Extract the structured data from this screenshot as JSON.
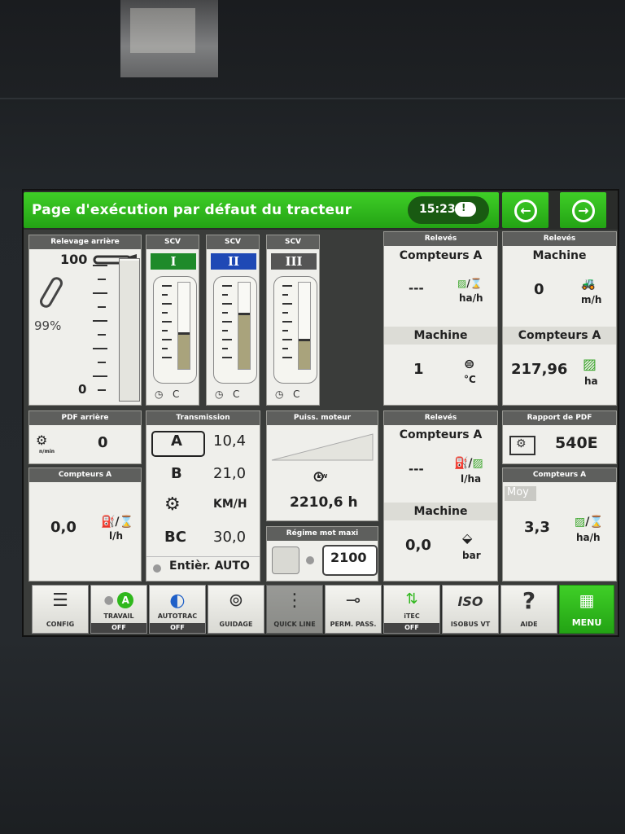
{
  "header": {
    "title": "Page d'exécution par défaut du tracteur",
    "time": "15:23"
  },
  "relevage": {
    "title": "Relevage arrière",
    "top": "100",
    "percent": "99%",
    "bottom": "0",
    "level": 0.99
  },
  "scv": [
    {
      "title": "SCV",
      "roman": "I",
      "color": "#1f8a2a",
      "level": 0.4
    },
    {
      "title": "SCV",
      "roman": "II",
      "color": "#1f49b5",
      "level": 0.62
    },
    {
      "title": "SCV",
      "roman": "III",
      "color": "#555555",
      "level": 0.32
    }
  ],
  "scv_labels": {
    "c": "C"
  },
  "releves_left": {
    "title": "Relevés",
    "sub1": "Compteurs A",
    "v1": "---",
    "u1": "ha/h",
    "sub2": "Machine",
    "v2": "1",
    "u2": "°C"
  },
  "releves_right": {
    "title": "Relevés",
    "sub1": "Machine",
    "v1": "0",
    "u1": "m/h",
    "sub2": "Compteurs A",
    "v2": "217,96",
    "u2": "ha"
  },
  "pdf_arriere": {
    "title": "PDF arrière",
    "value": "0",
    "unit": "n/min"
  },
  "compteurs_a_left": {
    "title": "Compteurs A",
    "value": "0,0",
    "unit": "l/h"
  },
  "transmission": {
    "title": "Transmission",
    "rows": [
      {
        "label": "A",
        "value": "10,4"
      },
      {
        "label": "B",
        "value": "21,0"
      },
      {
        "label": "",
        "value": "KM/H"
      },
      {
        "label": "BC",
        "value": "30,0"
      }
    ],
    "mode": "Entièr. AUTO"
  },
  "puissance": {
    "title": "Puiss. moteur",
    "value": "2210,6 h",
    "icon_label": "kW"
  },
  "regime": {
    "title": "Régime mot maxi",
    "value": "2100"
  },
  "releves_mid": {
    "title": "Relevés",
    "sub1": "Compteurs A",
    "v1": "---",
    "u1": "l/ha",
    "sub2": "Machine",
    "v2": "0,0",
    "u2": "bar"
  },
  "rapport_pdf": {
    "title": "Rapport de PDF",
    "value": "540E"
  },
  "compteurs_a_right": {
    "title": "Compteurs A",
    "moy": "Moy",
    "value": "3,3",
    "unit": "ha/h"
  },
  "dock": [
    {
      "label": "CONFIG",
      "off": ""
    },
    {
      "label": "TRAVAIL",
      "off": "OFF"
    },
    {
      "label": "AUTOTRAC",
      "off": "OFF"
    },
    {
      "label": "GUIDAGE",
      "off": ""
    },
    {
      "label": "QUICK LINE",
      "off": ""
    },
    {
      "label": "PERM. PASS.",
      "off": ""
    },
    {
      "label": "iTEC",
      "off": "OFF"
    },
    {
      "label": "ISOBUS VT",
      "off": ""
    },
    {
      "label": "AIDE",
      "off": ""
    },
    {
      "label": "MENU",
      "off": ""
    }
  ],
  "colors": {
    "accent_green": "#2fb81c",
    "panel_title": "#5e5f5d"
  }
}
